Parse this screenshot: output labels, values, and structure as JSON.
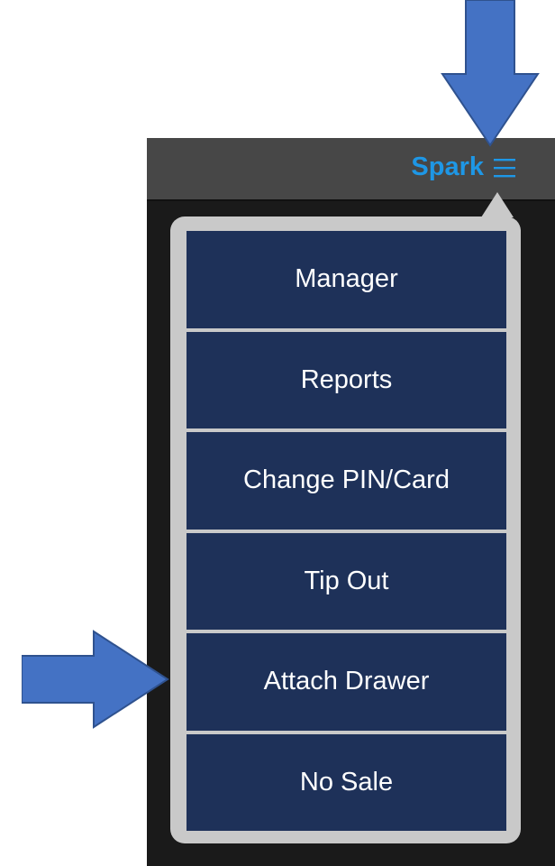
{
  "header": {
    "brand_label": "Spark",
    "menu_icon": "hamburger-icon",
    "accent_color": "#1e97e6"
  },
  "menu": {
    "items": [
      {
        "label": "Manager"
      },
      {
        "label": "Reports"
      },
      {
        "label": "Change PIN/Card"
      },
      {
        "label": "Tip Out"
      },
      {
        "label": "Attach Drawer"
      },
      {
        "label": "No Sale"
      }
    ],
    "item_color": "#1e3159",
    "popover_color": "#c9c9c9"
  },
  "annotations": {
    "arrow_color": "#4472c4",
    "arrows": [
      {
        "direction": "down",
        "points_to": "hamburger-icon"
      },
      {
        "direction": "right",
        "points_to": "Attach Drawer"
      }
    ]
  }
}
